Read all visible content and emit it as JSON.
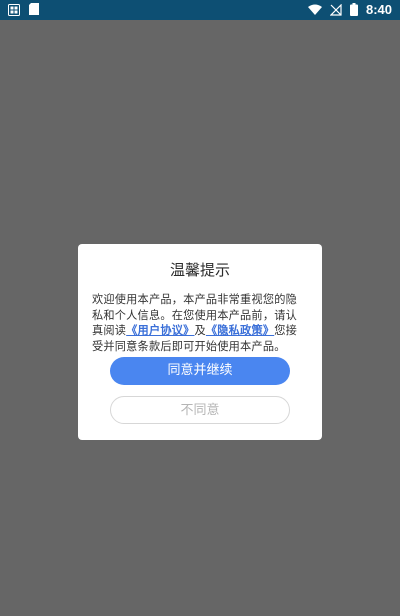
{
  "status_bar": {
    "time": "8:40",
    "icons": [
      "notification-app-icon",
      "sd-card-icon",
      "wifi-icon",
      "signal-muted-icon",
      "battery-icon"
    ]
  },
  "dialog": {
    "title": "温馨提示",
    "body": {
      "part1": "欢迎使用本产品，本产品非常重视您的隐私和个人信息。在您使用本产品前，请认真阅读",
      "link1": "《用户协议》",
      "part2": "及",
      "link2": "《隐私政策》",
      "part3": "您接受并同意条款后即可开始使用本产品。"
    },
    "agree_button": "同意并继续",
    "disagree_button": "不同意"
  },
  "colors": {
    "status_bar_bg": "#0d4f73",
    "backdrop": "#666666",
    "primary_button": "#4a86f0",
    "link": "#3a6fd8"
  }
}
